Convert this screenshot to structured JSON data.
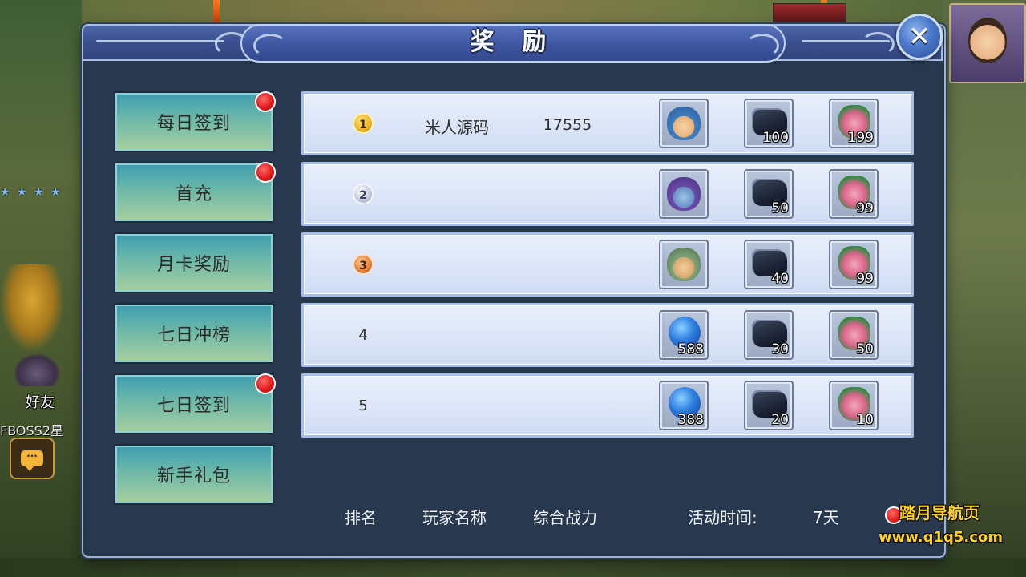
{
  "window": {
    "title": "奖 励"
  },
  "background": {
    "friend_label": "好友",
    "boss_label": "FBOSS2星"
  },
  "tabs": [
    {
      "label": "每日签到",
      "has_alert": true
    },
    {
      "label": "首充",
      "has_alert": true
    },
    {
      "label": "月卡奖励",
      "has_alert": false
    },
    {
      "label": "七日冲榜",
      "has_alert": false
    },
    {
      "label": "七日签到",
      "has_alert": true
    },
    {
      "label": "新手礼包",
      "has_alert": false
    }
  ],
  "rankings": [
    {
      "rank": "1",
      "medal": "gold",
      "player": "米人源码",
      "power": "17555",
      "rewards": [
        {
          "icon": "hero-portrait-icon",
          "count": ""
        },
        {
          "icon": "iron-ore-icon",
          "count": "100"
        },
        {
          "icon": "gift-bag-icon",
          "count": "199"
        }
      ]
    },
    {
      "rank": "2",
      "medal": "silver",
      "player": "",
      "power": "",
      "rewards": [
        {
          "icon": "hero-portrait-icon",
          "count": ""
        },
        {
          "icon": "iron-ore-icon",
          "count": "50"
        },
        {
          "icon": "gift-bag-icon",
          "count": "99"
        }
      ]
    },
    {
      "rank": "3",
      "medal": "bronze",
      "player": "",
      "power": "",
      "rewards": [
        {
          "icon": "hero-portrait-icon",
          "count": ""
        },
        {
          "icon": "iron-ore-icon",
          "count": "40"
        },
        {
          "icon": "gift-bag-icon",
          "count": "99"
        }
      ]
    },
    {
      "rank": "4",
      "medal": "none",
      "player": "",
      "power": "",
      "rewards": [
        {
          "icon": "blue-gem-icon",
          "count": "588"
        },
        {
          "icon": "iron-ore-icon",
          "count": "30"
        },
        {
          "icon": "gift-bag-icon",
          "count": "50"
        }
      ]
    },
    {
      "rank": "5",
      "medal": "none",
      "player": "",
      "power": "",
      "rewards": [
        {
          "icon": "blue-gem-icon",
          "count": "388"
        },
        {
          "icon": "iron-ore-icon",
          "count": "20"
        },
        {
          "icon": "gift-bag-icon",
          "count": "10"
        }
      ]
    }
  ],
  "footer": {
    "rank_header": "排名",
    "player_header": "玩家名称",
    "power_header": "综合战力",
    "time_label": "活动时间:",
    "time_value": "7天"
  },
  "watermark": {
    "title": "踏月导航页",
    "url": "www.q1q5.com"
  },
  "colors": {
    "panel_bg": "#26374c",
    "title_bar": "#3b4f8e",
    "tab_gradient_top": "#3c9db0",
    "row_bg": "#dde6f8",
    "alert_red": "#e11c1c",
    "watermark_yellow": "#ffd21f"
  }
}
